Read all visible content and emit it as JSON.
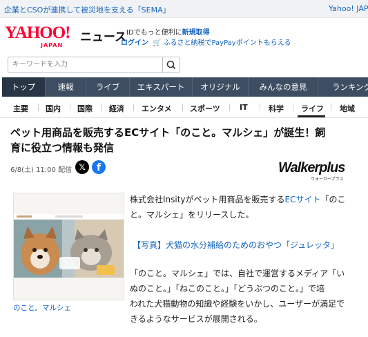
{
  "topbar": {
    "headline": "企業とCSOが連携して被災地を支える「SEMA」",
    "right": "Yahoo! JAPAN"
  },
  "header": {
    "logo_yahoo": "YAHOO!",
    "logo_japan": "JAPAN",
    "logo_news": "ニュース",
    "promo_line1_prefix": "IDでもっと便利に",
    "promo_line1_link": "新規取得",
    "login": "ログイン",
    "furusato": "ふるさと納税でPayPayポイントもらえる"
  },
  "search": {
    "placeholder": "キーワードを入力"
  },
  "gnav": [
    "トップ",
    "速報",
    "ライブ",
    "エキスパート",
    "オリジナル",
    "みんなの意見",
    "ランキング"
  ],
  "snav": [
    "主要",
    "国内",
    "国際",
    "経済",
    "エンタメ",
    "スポーツ",
    "IT",
    "科学",
    "ライフ",
    "地域"
  ],
  "article": {
    "title_line1": "ペット用商品を販売するECサイト「のこと。マルシェ」が誕生！飼",
    "title_line2": "育に役立つ情報も発信",
    "date": "6/8(土) 11:00 配信",
    "publisher_logo": "Walkerplus",
    "publisher_sub": "ウォーカープラス",
    "caption": "のこと。マルシェ",
    "p1_a": "株式会社Insityがペット用商品を販売する",
    "p1_link": "ECサイト",
    "p1_b": "「のこ",
    "p1_c": "と。マルシェ」をリリースした。",
    "photo_link": "【写真】犬猫の水分補給のためのおやつ「ジュレッタ」",
    "p2_l1": "「のこと。マルシェ」では、自社で運営するメディア「い",
    "p2_l2": "ぬのこと。」「ねこのこと。」「どうぶつのこと。」で培",
    "p2_l3": "われた犬猫動物の知識や経験をいかし、ユーザーが満足で",
    "p2_l4": "きるようなサービスが展開される。"
  },
  "colors": {
    "brand_red": "#ff0033",
    "nav_bg": "#3d4e63",
    "link_blue": "#1565c0",
    "facebook": "#1877f2"
  }
}
